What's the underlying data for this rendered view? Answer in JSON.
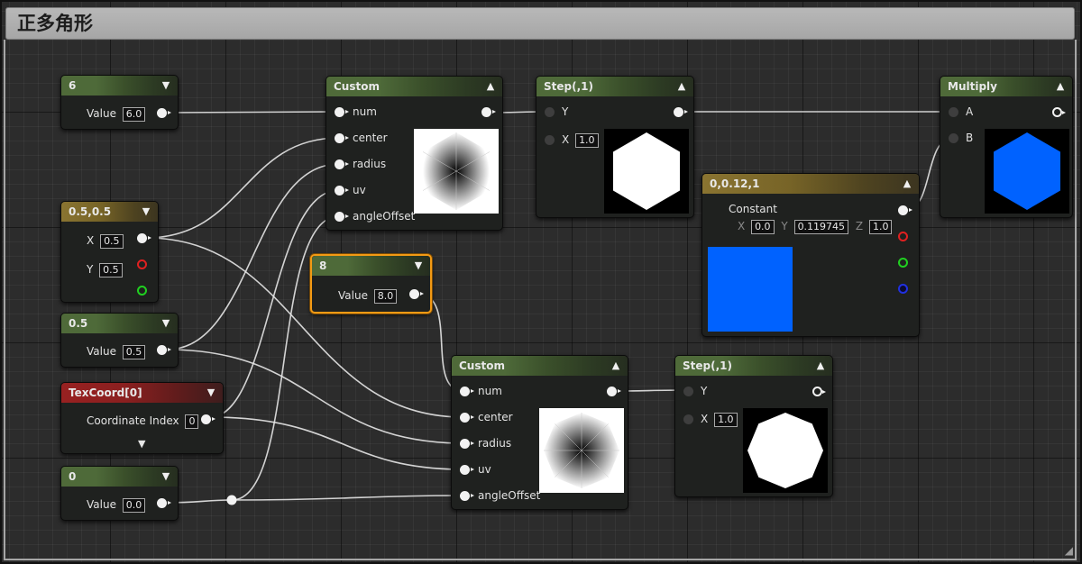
{
  "comment": {
    "title": "正多角形"
  },
  "nodes": {
    "const6": {
      "title": "6",
      "value_label": "Value",
      "value": "6.0"
    },
    "vec05": {
      "title": "0.5,0.5",
      "x_label": "X",
      "x_value": "0.5",
      "y_label": "Y",
      "y_value": "0.5"
    },
    "scalar05": {
      "title": "0.5",
      "value_label": "Value",
      "value": "0.5"
    },
    "texcoord": {
      "title": "TexCoord[0]",
      "label": "Coordinate Index",
      "value": "0"
    },
    "const0": {
      "title": "0",
      "value_label": "Value",
      "value": "0.0"
    },
    "custom1": {
      "title": "Custom",
      "pins": [
        "num",
        "center",
        "radius",
        "uv",
        "angleOffset"
      ]
    },
    "const8": {
      "title": "8",
      "value_label": "Value",
      "value": "8.0"
    },
    "custom2": {
      "title": "Custom",
      "pins": [
        "num",
        "center",
        "radius",
        "uv",
        "angleOffset"
      ]
    },
    "step1": {
      "title": "Step(,1)",
      "y_label": "Y",
      "x_label": "X",
      "x_value": "1.0"
    },
    "step2": {
      "title": "Step(,1)",
      "y_label": "Y",
      "x_label": "X",
      "x_value": "1.0"
    },
    "constvec": {
      "title": "0,0.12,1",
      "label": "Constant",
      "x_label": "X",
      "x_value": "0.0",
      "y_label": "Y",
      "y_value": "0.119745",
      "z_label": "Z",
      "z_value": "1.0"
    },
    "multiply": {
      "title": "Multiply",
      "a_label": "A",
      "b_label": "B"
    }
  },
  "colors": {
    "header_green": "#4f6a39",
    "header_gold": "#8a7431",
    "header_red": "#982121",
    "selection": "#f39a14",
    "preview_blue": "#0062ff"
  },
  "icons": {
    "collapse": "chevron-up-icon",
    "expand": "chevron-down-icon"
  }
}
